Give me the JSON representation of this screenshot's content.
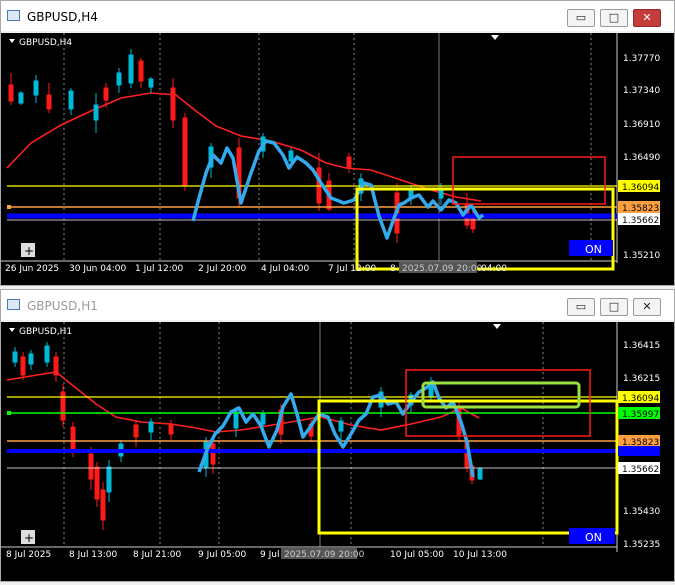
{
  "windows": [
    {
      "title": "GBPUSD,H4",
      "symbol_label": "GBPUSD,H4",
      "price_labels": [
        "1.37770",
        "1.37340",
        "1.36910",
        "1.36490",
        "1.35210"
      ],
      "tagged_prices": [
        {
          "value": "1.36094",
          "color": "#ffff00"
        },
        {
          "value": "1.35823",
          "color": "#ffa040"
        },
        {
          "value": "1.35662",
          "color": "#ffffff"
        }
      ],
      "time_labels": [
        "26 Jun 2025",
        "30 Jun 04:00",
        "1 Jul 12:00",
        "2 Jul 20:00",
        "4 Jul 04:00",
        "7 Jul 12:00",
        "8",
        "2025.07.09 20:00",
        "04:00"
      ],
      "on_label": "ON",
      "plus_label": "+"
    },
    {
      "title": "GBPUSD,H1",
      "symbol_label": "GBPUSD,H1",
      "price_labels": [
        "1.36415",
        "1.36215",
        "1.35430",
        "1.35235"
      ],
      "tagged_prices": [
        {
          "value": "1.36094",
          "color": "#ffff00"
        },
        {
          "value": "1.35997",
          "color": "#00ff00"
        },
        {
          "value": "1.35823",
          "color": "#ffa040"
        },
        {
          "value": "1.35662",
          "color": "#ffffff"
        }
      ],
      "time_labels": [
        "8 Jul 2025",
        "8 Jul 13:00",
        "8 Jul 21:00",
        "9 Jul 05:00",
        "9 Jul 13:00",
        "2025.07.09 20:00",
        "10 Jul 05:00",
        "10 Jul 13:00"
      ],
      "on_label": "ON",
      "plus_label": "+"
    }
  ],
  "window_controls": {
    "minimize": "▭",
    "maximize": "□",
    "close": "✕"
  },
  "colors": {
    "chart_bg": "#000000",
    "bull_candle": "#00b8d8",
    "bear_candle": "#ff1a1a",
    "moving_average": "#ff2020",
    "trend_drawing": "#33aaee",
    "yellow_level": "#ffff00",
    "orange_level": "#ffa040",
    "green_level": "#00ff00",
    "blue_level": "#0000ff",
    "on_badge": "#0000ff"
  }
}
